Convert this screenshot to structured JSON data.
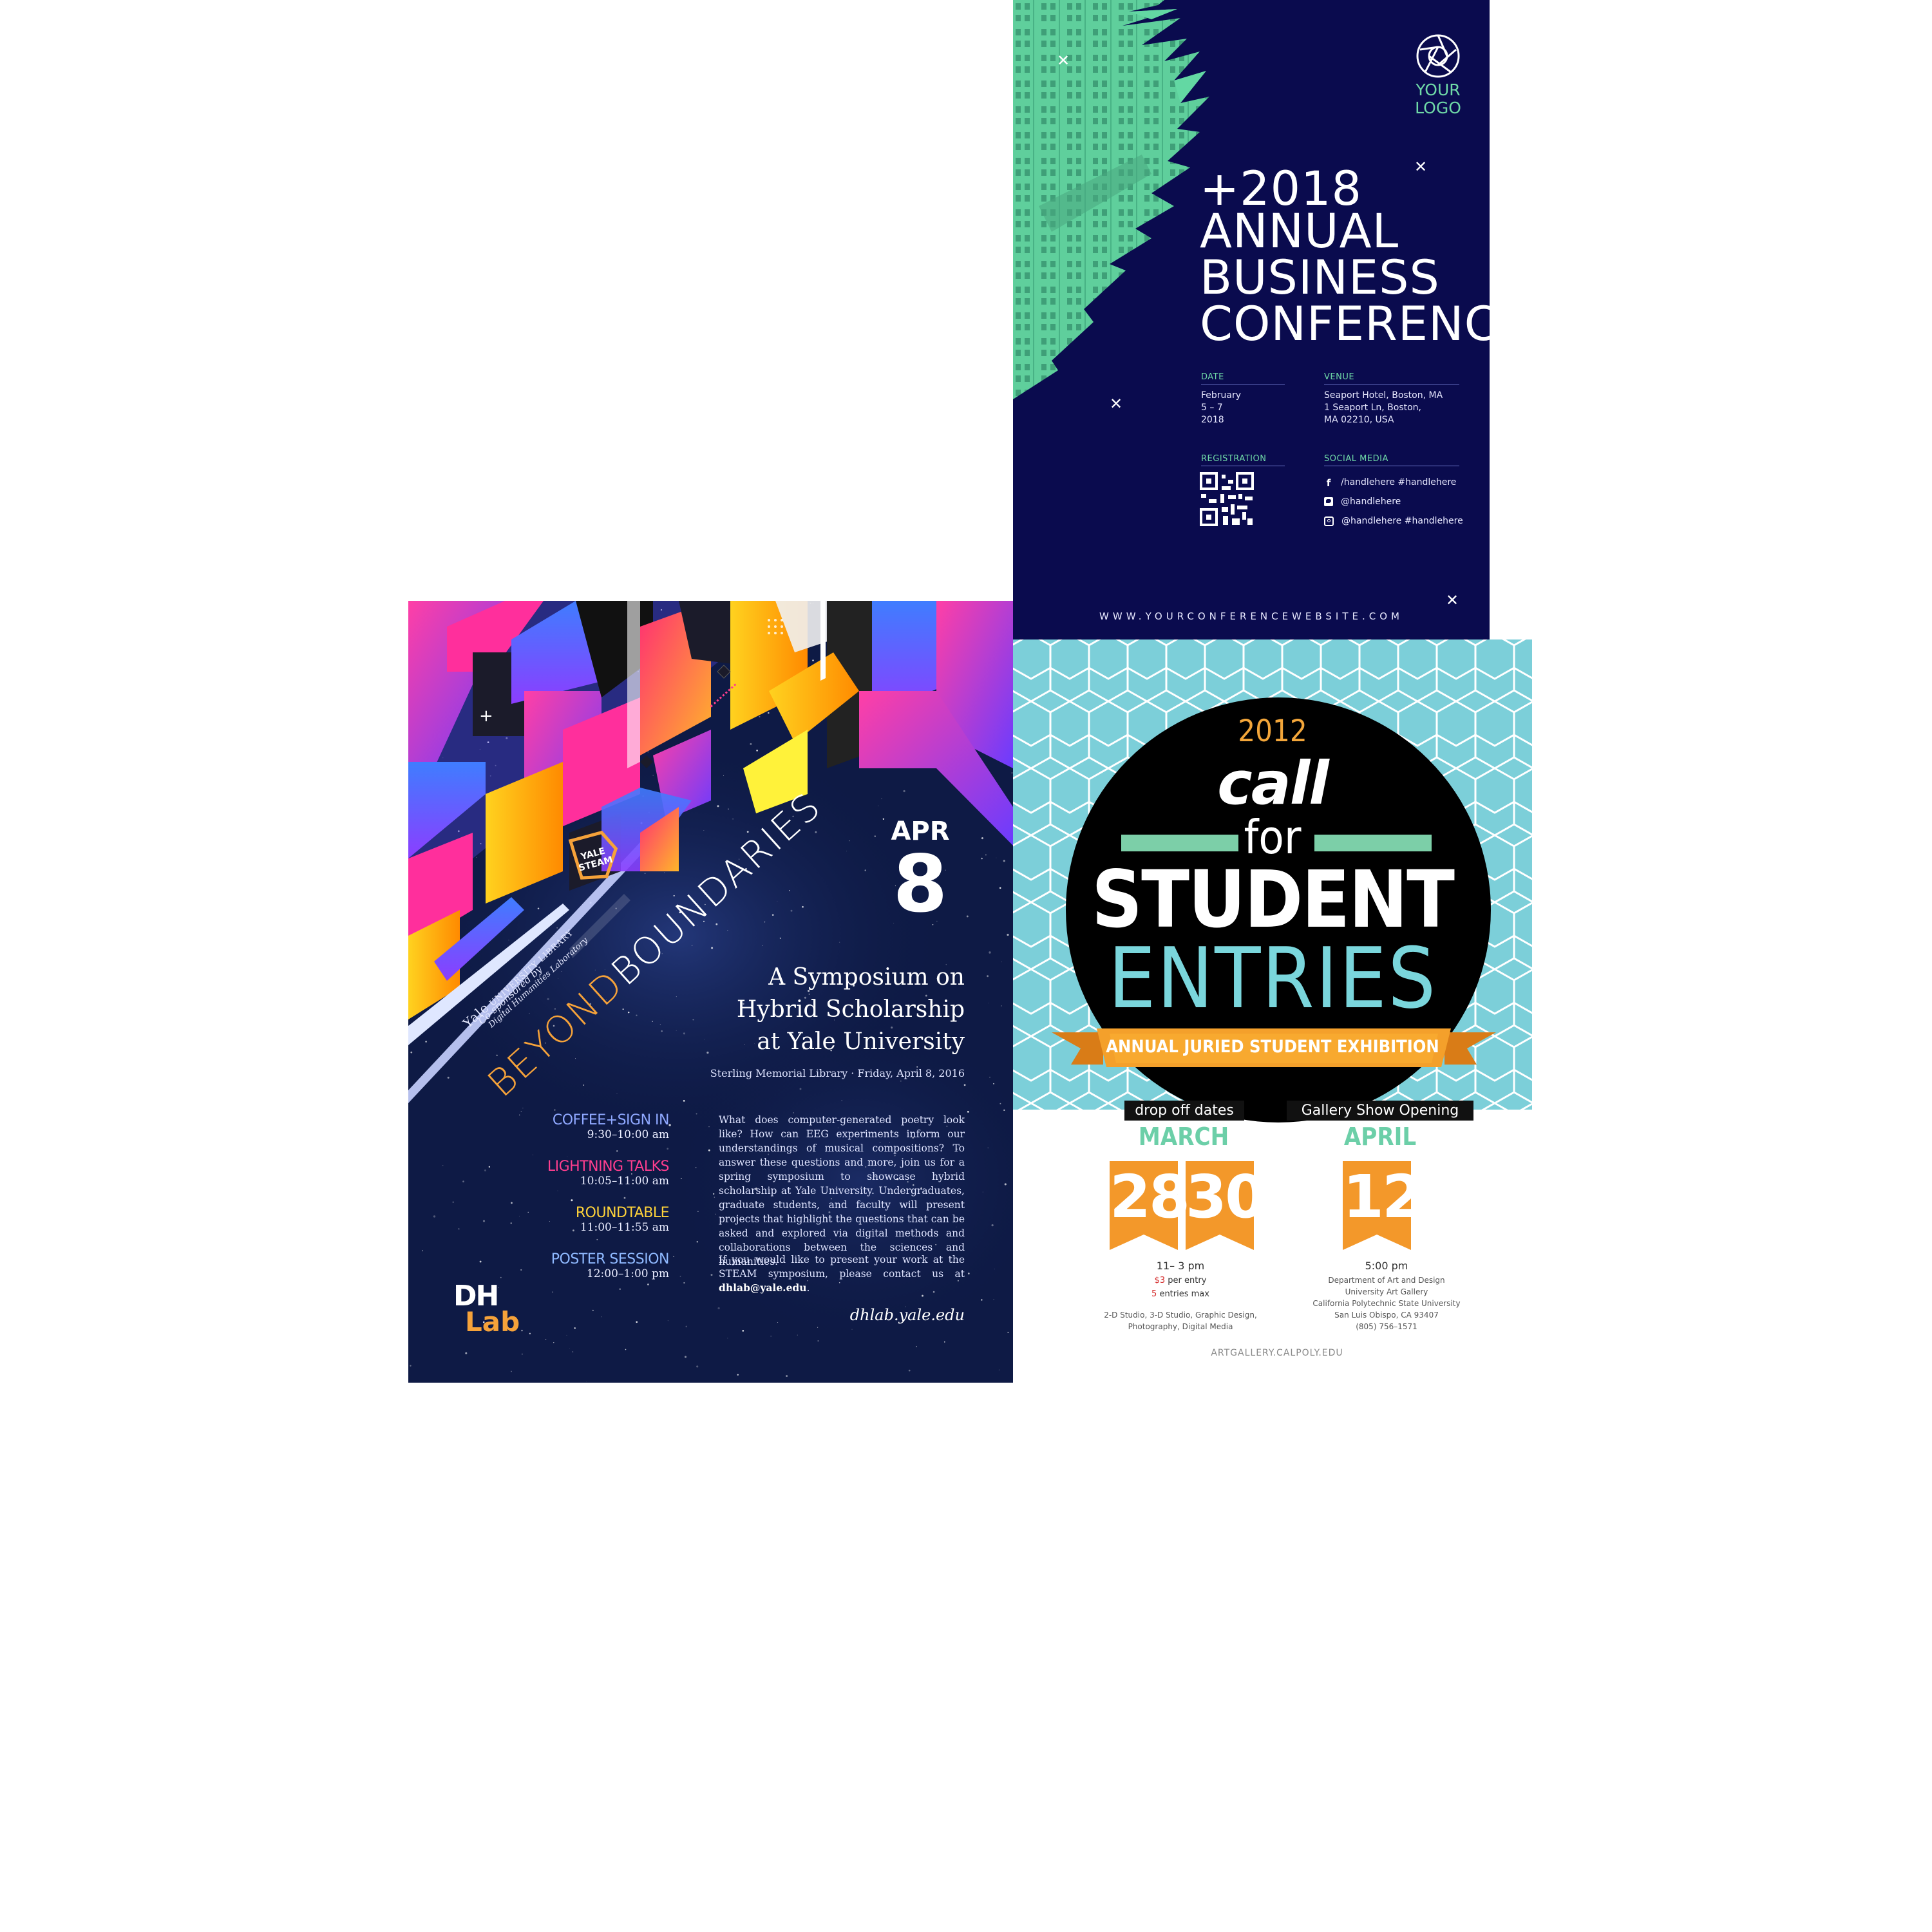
{
  "business": {
    "logo_line1": "YOUR",
    "logo_line2": "LOGO",
    "title_lines": [
      "+2018",
      "ANNUAL",
      "BUSINESS",
      "CONFERENCE"
    ],
    "date_label": "DATE",
    "date_lines": [
      "February",
      "5 – 7",
      "2018"
    ],
    "venue_label": "VENUE",
    "venue_lines": [
      "Seaport Hotel, Boston, MA",
      "1 Seaport Ln, Boston,",
      "MA 02210, USA"
    ],
    "registration_label": "REGISTRATION",
    "social_label": "SOCIAL MEDIA",
    "social": [
      {
        "icon": "facebook-icon",
        "text": "/handlehere #handlehere"
      },
      {
        "icon": "twitter-icon",
        "text": "@handlehere"
      },
      {
        "icon": "instagram-icon",
        "text": "@handlehere #handlehere"
      }
    ],
    "website": "WWW.YOURCONFERENCEWEBSITE.COM",
    "colors": {
      "bg": "#0a0b4e",
      "accent": "#6fd9a7"
    }
  },
  "student": {
    "year": "2012",
    "call": "call",
    "for": "for",
    "student": "STUDENT",
    "entries": "ENTRIES",
    "banner": "ANNUAL JURIED STUDENT EXHIBITION",
    "dropoff_tag": "drop off dates",
    "gallery_tag": "Gallery Show Opening",
    "month1": "MARCH",
    "day1": "28",
    "day2": "30",
    "month2": "APRIL",
    "day3": "12",
    "dropoff_time": "11– 3 pm",
    "fee_amount": "$3",
    "fee_suffix": " per entry",
    "max_num": "5",
    "max_suffix": " entries max",
    "categories_lines": [
      "2-D Studio, 3-D Studio, Graphic Design,",
      "Photography, Digital Media"
    ],
    "gallery_time": "5:00 pm",
    "gallery_lines": [
      "Department of Art and Design",
      "University Art Gallery",
      "California Polytechnic State University",
      "San Luis Obispo, CA 93407",
      "(805) 756–1571"
    ],
    "website": "ARTGALLERY.CALPOLY.EDU",
    "colors": {
      "hex_bg": "#7dd3de",
      "orange": "#f3982a",
      "green": "#6ccfa8"
    }
  },
  "yale": {
    "title_beyond": "BEYOND",
    "title_boundaries": "BOUNDARIES",
    "cosponsored": "Co-sponsored by",
    "yale_word": "Yale",
    "library": "UNIVERSITY LIBRARY",
    "dhlab_full": "Digital Humanities Laboratory",
    "steam_line1": "YALE",
    "steam_line2": "STEAM",
    "month": "APR",
    "day": "8",
    "subtitle_lines": [
      "A Symposium on",
      "Hybrid Scholarship",
      "at Yale University"
    ],
    "location": "Sterling Memorial Library · Friday, April 8, 2016",
    "schedule": [
      {
        "name": "COFFEE+SIGN IN",
        "time": "9:30–10:00 am",
        "color": "#8fa8ff"
      },
      {
        "name": "LIGHTNING TALKS",
        "time": "10:05–11:00 am",
        "color": "#ff3e8e"
      },
      {
        "name": "ROUNDTABLE",
        "time": "11:00–11:55 am",
        "color": "#ffd33a"
      },
      {
        "name": "POSTER SESSION",
        "time": "12:00–1:00 pm",
        "color": "#8fb9ff"
      }
    ],
    "description": "What does computer-generated poetry look like? How can EEG experiments inform our understandings of musical compositions? To answer these questions and more, join us for a spring symposium to showcase hybrid scholarship at Yale University. Undergraduates, graduate students, and faculty will present projects that highlight the questions that can be asked and explored via digital methods and collaborations between the sciences and humanities.",
    "contact_prefix": "If you would like to present your work at the STEAM symposium, please contact us at ",
    "contact_email": "dhlab@yale.edu",
    "contact_suffix": ".",
    "logo_dh": "DH",
    "logo_lab": "Lab",
    "website": "dhlab.yale.edu",
    "colors": {
      "bg": "#0e1a45",
      "orange": "#f5a23a"
    }
  }
}
